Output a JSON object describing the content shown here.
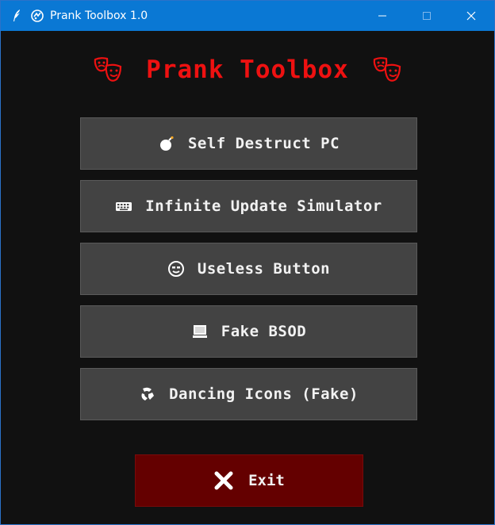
{
  "window": {
    "title": "Prank Toolbox 1.0"
  },
  "header": {
    "title": "Prank Toolbox",
    "left_icon": "theater-masks-icon",
    "right_icon": "theater-masks-icon"
  },
  "buttons": [
    {
      "label": "Self Destruct PC",
      "icon": "bomb-icon"
    },
    {
      "label": "Infinite Update Simulator",
      "icon": "keyboard-icon"
    },
    {
      "label": "Useless Button",
      "icon": "smiley-face-icon"
    },
    {
      "label": "Fake BSOD",
      "icon": "monitor-icon"
    },
    {
      "label": "Dancing Icons (Fake)",
      "icon": "dancing-icon"
    }
  ],
  "exit": {
    "label": "Exit",
    "icon": "close-x-icon"
  },
  "colors": {
    "titlebar": "#0a78d4",
    "background": "#111111",
    "heading": "#ee1111",
    "button": "#434343",
    "exit_button": "#640000"
  }
}
